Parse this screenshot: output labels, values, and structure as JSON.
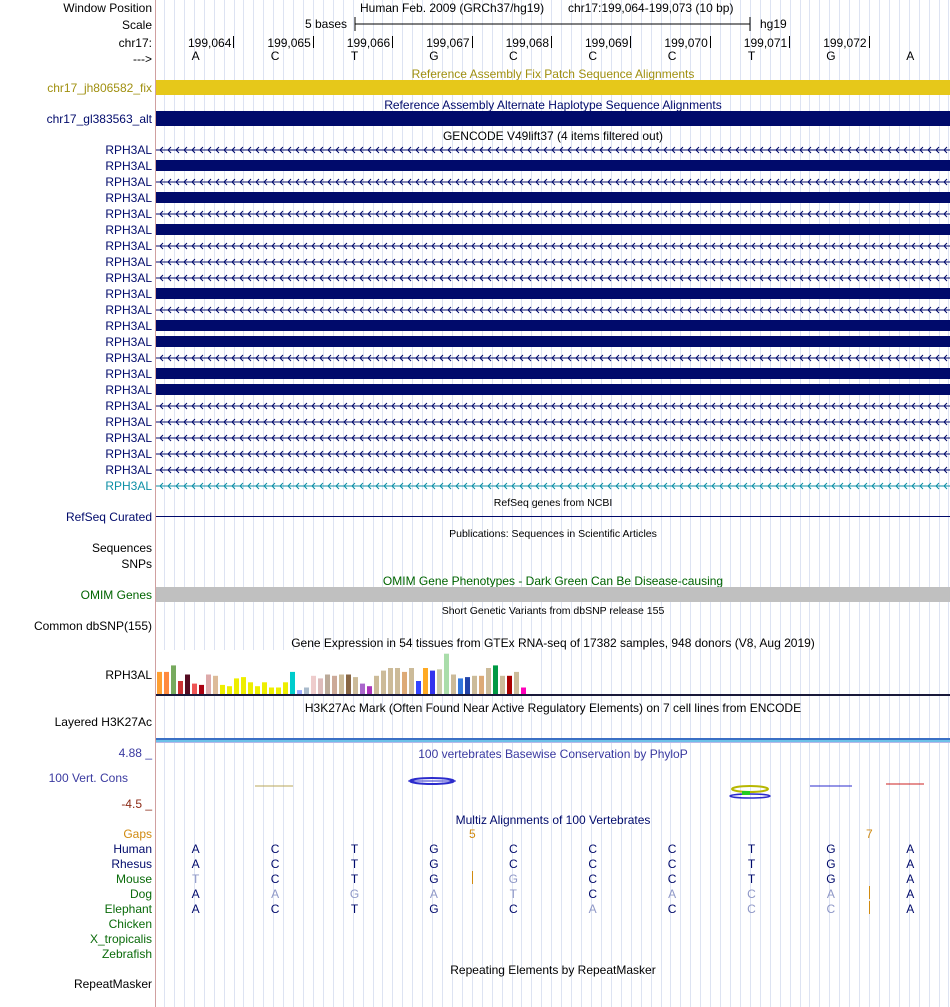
{
  "header": {
    "window_position_label": "Window Position",
    "scale_label": "Scale",
    "chrom_label": "chr17:",
    "strand_label": "--->",
    "assembly_title": "Human Feb. 2009 (GRCh37/hg19)",
    "position": "chr17:199,064-199,073 (10 bp)",
    "scale_text": "5 bases",
    "db_label": "hg19",
    "ticks": [
      "199,064",
      "199,065",
      "199,066",
      "199,067",
      "199,068",
      "199,069",
      "199,070",
      "199,071",
      "199,072"
    ],
    "bases": [
      "A",
      "C",
      "T",
      "G",
      "C",
      "C",
      "C",
      "T",
      "G",
      "A"
    ]
  },
  "tracks": {
    "fix_patch": {
      "title": "Reference Assembly Fix Patch Sequence Alignments",
      "label": "chr17_jh806582_fix",
      "color": "#e6c81a"
    },
    "alt_haplo": {
      "title": "Reference Assembly Alternate Haplotype Sequence Alignments",
      "label": "chr17_gl383563_alt",
      "color": "#000a6b"
    },
    "gencode": {
      "title": "GENCODE V49lift37 (4 items filtered out)",
      "items": [
        {
          "label": "RPH3AL",
          "style": "thin"
        },
        {
          "label": "RPH3AL",
          "style": "thick"
        },
        {
          "label": "RPH3AL",
          "style": "thin"
        },
        {
          "label": "RPH3AL",
          "style": "thick"
        },
        {
          "label": "RPH3AL",
          "style": "thin"
        },
        {
          "label": "RPH3AL",
          "style": "thick"
        },
        {
          "label": "RPH3AL",
          "style": "thin"
        },
        {
          "label": "RPH3AL",
          "style": "thin"
        },
        {
          "label": "RPH3AL",
          "style": "thin"
        },
        {
          "label": "RPH3AL",
          "style": "thick"
        },
        {
          "label": "RPH3AL",
          "style": "thin"
        },
        {
          "label": "RPH3AL",
          "style": "thick"
        },
        {
          "label": "RPH3AL",
          "style": "thick"
        },
        {
          "label": "RPH3AL",
          "style": "thin"
        },
        {
          "label": "RPH3AL",
          "style": "thick"
        },
        {
          "label": "RPH3AL",
          "style": "thick"
        },
        {
          "label": "RPH3AL",
          "style": "thin"
        },
        {
          "label": "RPH3AL",
          "style": "thin"
        },
        {
          "label": "RPH3AL",
          "style": "thin"
        },
        {
          "label": "RPH3AL",
          "style": "thin"
        },
        {
          "label": "RPH3AL",
          "style": "thin"
        },
        {
          "label": "RPH3AL",
          "style": "thin-teal"
        }
      ]
    },
    "refseq": {
      "title": "RefSeq genes from NCBI",
      "label": "RefSeq Curated"
    },
    "publications": {
      "title": "Publications: Sequences in Scientific Articles",
      "labels": [
        "Sequences",
        "SNPs"
      ]
    },
    "omim": {
      "title": "OMIM Gene Phenotypes - Dark Green Can Be Disease-causing",
      "label": "OMIM Genes",
      "color": "#006400"
    },
    "dbsnp": {
      "title": "Short Genetic Variants from dbSNP release 155",
      "label": "Common dbSNP(155)"
    },
    "gtex": {
      "title": "Gene Expression in 54 tissues from GTEx RNA-seq of 17382 samples, 948 donors (V8, Aug 2019)",
      "label": "RPH3AL",
      "colors": [
        "#ff9f31",
        "#ff8a3e",
        "#77aa5e",
        "#cc3333",
        "#550c22",
        "#ee5555",
        "#aa0011",
        "#ddaaaa",
        "#ddbb99",
        "#eeee00",
        "#eeee00",
        "#eeee00",
        "#eeee00",
        "#eeee00",
        "#eeee00",
        "#eeee00",
        "#eeee00",
        "#eeee00",
        "#eeee00",
        "#00cccc",
        "#99aaff",
        "#aabbcc",
        "#eecccc",
        "#ddbbbb",
        "#bbaa99",
        "#ccaa99",
        "#ccbb99",
        "#886644",
        "#ccbb99",
        "#aa66cc",
        "#aa33bb",
        "#ccbb99",
        "#ccbb99",
        "#ccbb99",
        "#ccbb99",
        "#ddaa77",
        "#ccbb99",
        "#3344ff",
        "#ffaa22",
        "#3333ee",
        "#ccccaa",
        "#aaddaa",
        "#ccbb99",
        "#3377dd",
        "#2244aa",
        "#ccbb99",
        "#ddaa77",
        "#ccbb99",
        "#009944",
        "#ccbb99",
        "#aa0000",
        "#ccbb99",
        "#ff00bb"
      ],
      "values": [
        8.5,
        8.5,
        11,
        5,
        7.5,
        4,
        3.5,
        7.5,
        7,
        3.5,
        3,
        6,
        6.5,
        4.5,
        3,
        4.5,
        2.5,
        2.5,
        4.5,
        8.5,
        1.5,
        2.5,
        7,
        6,
        7.5,
        7,
        7.5,
        7.5,
        6.5,
        4,
        3,
        7,
        9,
        10,
        10,
        8.5,
        10,
        5,
        10,
        9,
        9.5,
        15.5,
        7.5,
        6,
        6.5,
        7,
        7,
        10,
        11,
        7,
        7,
        8.5,
        2.5
      ]
    },
    "h3k27ac": {
      "title": "H3K27Ac Mark (Often Found Near Active Regulatory Elements) on 7 cell lines from ENCODE",
      "label": "Layered H3K27Ac"
    },
    "phylop": {
      "title": "100 vertebrates Basewise Conservation by PhyloP",
      "label": "100 Vert. Cons",
      "max": "4.88 _",
      "min": "-4.5 _"
    },
    "multiz": {
      "title": "Multiz Alignments of 100 Vertebrates",
      "gaps_label": "Gaps",
      "gap_marks": [
        "5",
        "7"
      ],
      "species": [
        {
          "name": "Human",
          "bases": [
            "A",
            "C",
            "T",
            "G",
            "C",
            "C",
            "C",
            "T",
            "G",
            "A"
          ]
        },
        {
          "name": "Rhesus",
          "bases": [
            "A",
            "C",
            "T",
            "G",
            "C",
            "C",
            "C",
            "T",
            "G",
            "A"
          ]
        },
        {
          "name": "Mouse",
          "bases": [
            "T",
            "C",
            "T",
            "G",
            "G",
            "C",
            "C",
            "T",
            "G",
            "A"
          ]
        },
        {
          "name": "Dog",
          "bases": [
            "A",
            "A",
            "G",
            "A",
            "T",
            "C",
            "A",
            "C",
            "A",
            "A"
          ]
        },
        {
          "name": "Elephant",
          "bases": [
            "A",
            "C",
            "T",
            "G",
            "C",
            "A",
            "C",
            "C",
            "C",
            "A"
          ]
        },
        {
          "name": "Chicken",
          "bases": []
        },
        {
          "name": "X_tropicalis",
          "bases": []
        },
        {
          "name": "Zebrafish",
          "bases": []
        }
      ]
    },
    "repeatmasker": {
      "title": "Repeating Elements by RepeatMasker",
      "label": "RepeatMasker"
    }
  },
  "colors": {
    "label_navy": "#000a6b",
    "label_olive": "#a09010",
    "gencode_teal": "#0c8fa6",
    "omim_gray": "#c0c0c0",
    "phylop_blue": "#3a3aa0",
    "phylop_red": "#8b2a16",
    "gaps_orange": "#d08a10",
    "species_green": "#0a6b0a"
  }
}
